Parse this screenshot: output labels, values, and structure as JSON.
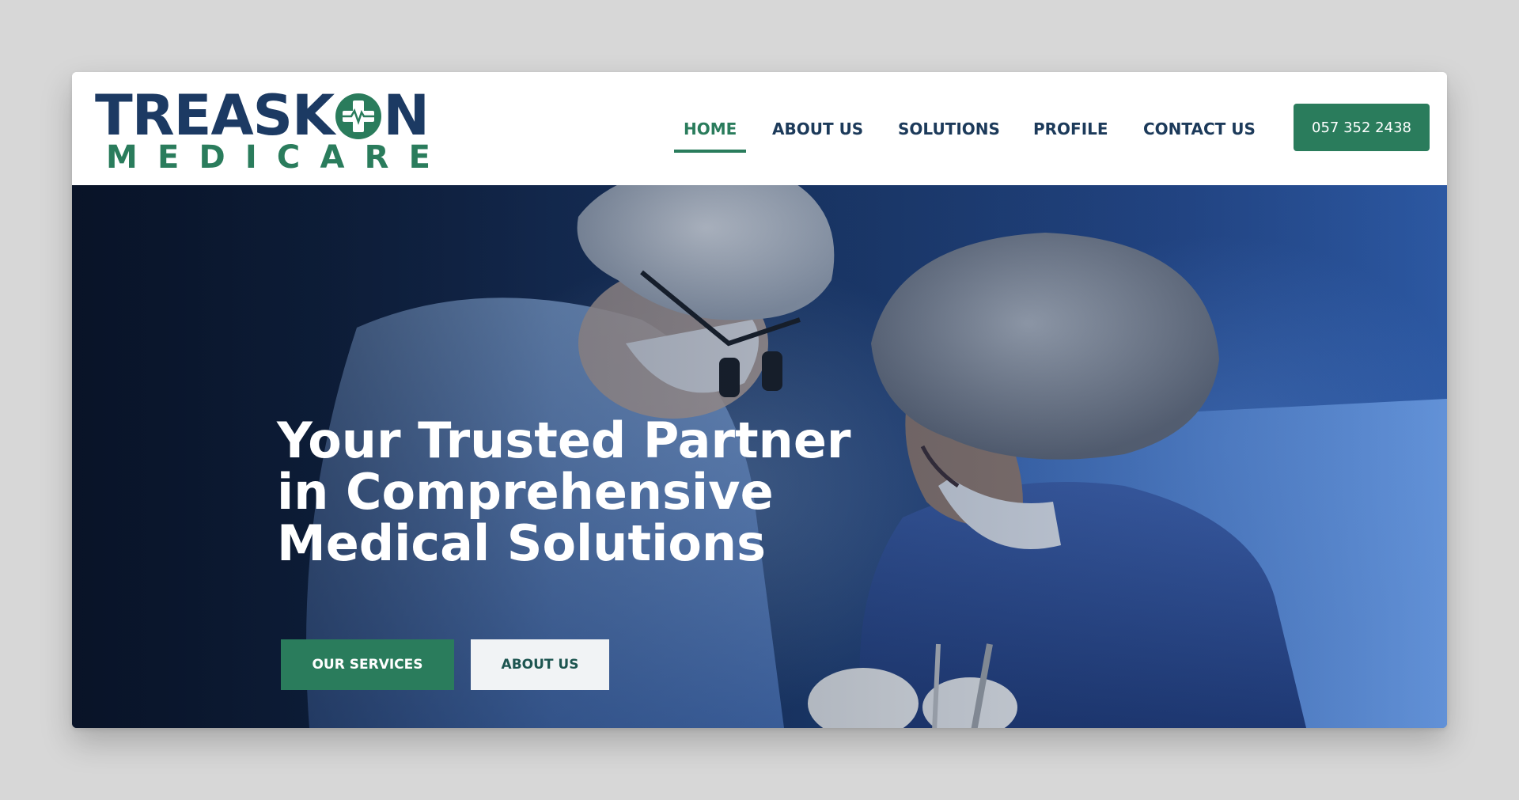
{
  "brand": {
    "logo_top_left": "TREASK",
    "logo_top_right": "N",
    "logo_bottom_letters": [
      "M",
      "E",
      "D",
      "I",
      "C",
      "A",
      "R",
      "E"
    ]
  },
  "nav": {
    "items": [
      {
        "label": "HOME",
        "active": true
      },
      {
        "label": "ABOUT US",
        "active": false
      },
      {
        "label": "SOLUTIONS",
        "active": false
      },
      {
        "label": "PROFILE",
        "active": false
      },
      {
        "label": "CONTACT US",
        "active": false
      }
    ],
    "phone_label": "057 352 2438"
  },
  "hero": {
    "title_lines": [
      "Your Trusted Partner",
      "in Comprehensive",
      "Medical Solutions"
    ],
    "primary_button": "OUR SERVICES",
    "secondary_button": "ABOUT US"
  },
  "colors": {
    "navy": "#1c3a63",
    "green": "#2a7c5c",
    "page_background": "#d7d7d7",
    "hero_text": "#ffffff"
  },
  "icons": {
    "logo_o": "medical-cross-heartbeat-icon"
  }
}
